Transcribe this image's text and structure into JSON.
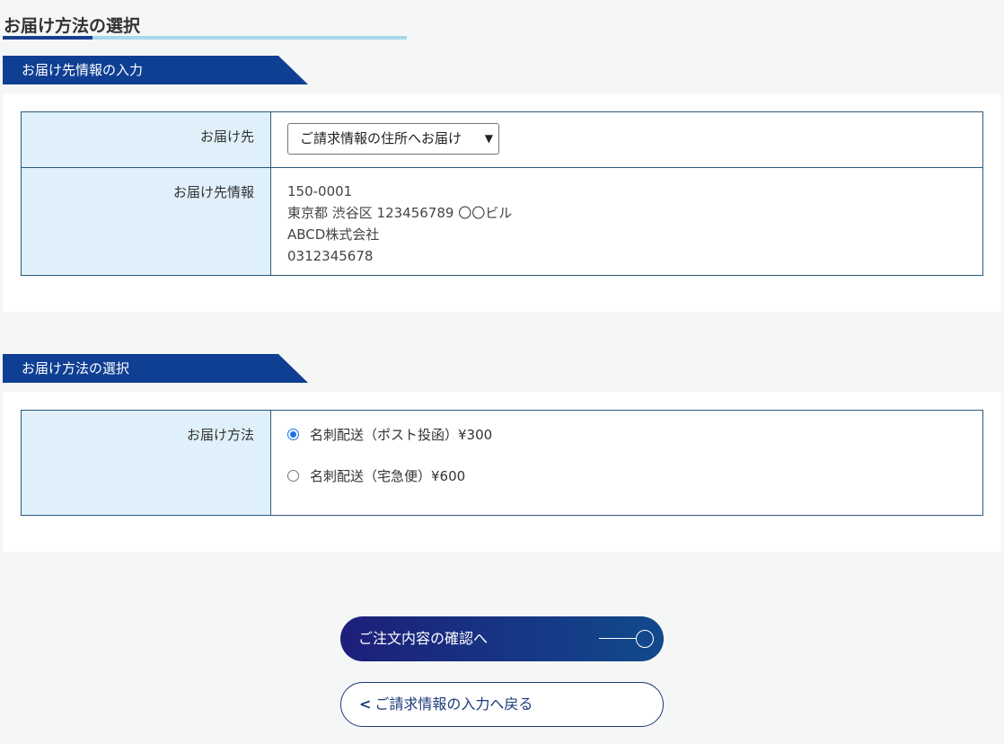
{
  "page": {
    "title": "お届け方法の選択"
  },
  "section1": {
    "tab_label": "お届け先情報の入力",
    "destination_label": "お届け先",
    "destination_selected": "ご請求情報の住所へお届け",
    "info_label": "お届け先情報",
    "address": {
      "postal_code": "150-0001",
      "street": "東京都 渋谷区 123456789 〇〇ビル",
      "company": "ABCD株式会社",
      "phone": "0312345678"
    }
  },
  "section2": {
    "tab_label": "お届け方法の選択",
    "method_label": "お届け方法",
    "options": [
      {
        "label": "名刺配送（ポスト投函）¥300",
        "checked": true
      },
      {
        "label": "名刺配送（宅急便）¥600",
        "checked": false
      }
    ]
  },
  "buttons": {
    "confirm_label": "ご注文内容の確認へ",
    "back_label": "ご請求情報の入力へ戻る"
  },
  "colors": {
    "primary": "#0f3f93",
    "label_bg": "#dff0fa",
    "border": "#2a5a7e",
    "underline": "#a9d8ea"
  }
}
